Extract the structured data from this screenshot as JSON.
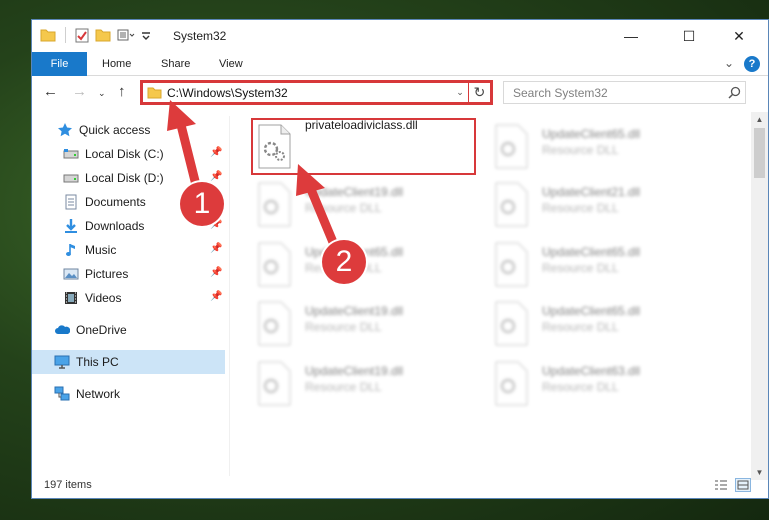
{
  "window": {
    "title": "System32",
    "controls": {
      "minimize": "—",
      "maximize": "☐",
      "close": "✕"
    }
  },
  "ribbon": {
    "file_tab": "File",
    "tabs": [
      "Home",
      "Share",
      "View"
    ]
  },
  "address": {
    "path": "C:\\Windows\\System32"
  },
  "search": {
    "placeholder": "Search System32"
  },
  "sidebar": {
    "items": [
      {
        "label": "Quick access",
        "icon": "star-icon"
      },
      {
        "label": "Local Disk (C:)",
        "icon": "drive-icon",
        "pinned": true
      },
      {
        "label": "Local Disk (D:)",
        "icon": "drive-icon",
        "pinned": true
      },
      {
        "label": "Documents",
        "icon": "documents-icon",
        "pinned": true
      },
      {
        "label": "Downloads",
        "icon": "download-icon",
        "pinned": true
      },
      {
        "label": "Music",
        "icon": "music-icon",
        "pinned": true
      },
      {
        "label": "Pictures",
        "icon": "pictures-icon",
        "pinned": true
      },
      {
        "label": "Videos",
        "icon": "videos-icon",
        "pinned": true
      },
      {
        "label": "OneDrive",
        "icon": "cloud-icon"
      },
      {
        "label": "This PC",
        "icon": "computer-icon",
        "selected": true
      },
      {
        "label": "Network",
        "icon": "network-icon"
      }
    ]
  },
  "files": [
    {
      "name": "privateloadiviclass.dll",
      "type": ""
    },
    {
      "name": "UpdateClient65.dll",
      "type": "Resource DLL"
    },
    {
      "name": "UpdateClient19.dll",
      "type": "Resource DLL"
    },
    {
      "name": "UpdateClient21.dll",
      "type": "Resource DLL"
    },
    {
      "name": "UpdateClient65.dll",
      "type": "Resource DLL"
    },
    {
      "name": "UpdateClient65.dll",
      "type": "Resource DLL"
    },
    {
      "name": "UpdateClient19.dll",
      "type": "Resource DLL"
    },
    {
      "name": "UpdateClient65.dll",
      "type": "Resource DLL"
    },
    {
      "name": "UpdateClient19.dll",
      "type": "Resource DLL"
    },
    {
      "name": "UpdateClient63.dll",
      "type": "Resource DLL"
    }
  ],
  "status": {
    "item_count": "197 items"
  },
  "annotations": {
    "step1": "1",
    "step2": "2"
  },
  "colors": {
    "accent": "#1979ca",
    "highlight": "#d7383a",
    "selected": "#cce4f7"
  }
}
